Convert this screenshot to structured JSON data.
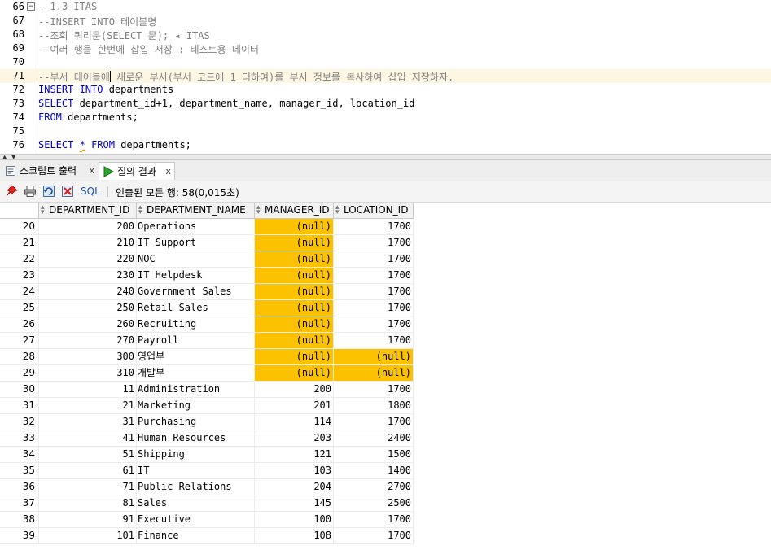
{
  "editor": {
    "lines": [
      {
        "num": "66",
        "text": "--1.3 ITAS",
        "fold": true
      },
      {
        "num": "67",
        "text": "--INSERT INTO 테이블명"
      },
      {
        "num": "68",
        "text": "--조회 쿼리문(SELECT 문); ◂ ITAS"
      },
      {
        "num": "69",
        "text": "--여러 행을 한번에 삽입 저장 : 테스트용 데이터"
      },
      {
        "num": "70",
        "text": ""
      },
      {
        "num": "71",
        "text_a": "--부서 테이블에",
        "text_b": "새로운 부서(부서 코드에 1 더하여)를 부서 정보를 복사하여 삽입 저장하자."
      },
      {
        "num": "72",
        "kw": "INSERT INTO",
        "rest": " departments"
      },
      {
        "num": "73",
        "kw": "SELECT",
        "rest": " department_id+1, department_name, manager_id, location_id"
      },
      {
        "num": "74",
        "kw": "FROM",
        "rest": " departments;"
      },
      {
        "num": "75",
        "text": ""
      },
      {
        "num": "76",
        "kw": "SELECT",
        "star": "*",
        "kw2": "FROM",
        "rest": " departments;"
      }
    ]
  },
  "tabs": [
    {
      "label": "스크립트 출력",
      "close": "x",
      "icon": "script-output-icon"
    },
    {
      "label": "질의 결과",
      "close": "x",
      "icon": "run-icon"
    }
  ],
  "toolbar": {
    "sql_label": "SQL",
    "status": "인출된 모든 행: 58(0,015초)"
  },
  "grid": {
    "headers": [
      "DEPARTMENT_ID",
      "DEPARTMENT_NAME",
      "MANAGER_ID",
      "LOCATION_ID"
    ],
    "highlight_color": "#fcc200",
    "rows": [
      {
        "rn": "20",
        "id": "200",
        "name": "Operations",
        "mgr": "(null)",
        "loc": "1700",
        "mgr_null": true
      },
      {
        "rn": "21",
        "id": "210",
        "name": "IT Support",
        "mgr": "(null)",
        "loc": "1700",
        "mgr_null": true
      },
      {
        "rn": "22",
        "id": "220",
        "name": "NOC",
        "mgr": "(null)",
        "loc": "1700",
        "mgr_null": true
      },
      {
        "rn": "23",
        "id": "230",
        "name": "IT Helpdesk",
        "mgr": "(null)",
        "loc": "1700",
        "mgr_null": true
      },
      {
        "rn": "24",
        "id": "240",
        "name": "Government Sales",
        "mgr": "(null)",
        "loc": "1700",
        "mgr_null": true
      },
      {
        "rn": "25",
        "id": "250",
        "name": "Retail Sales",
        "mgr": "(null)",
        "loc": "1700",
        "mgr_null": true
      },
      {
        "rn": "26",
        "id": "260",
        "name": "Recruiting",
        "mgr": "(null)",
        "loc": "1700",
        "mgr_null": true
      },
      {
        "rn": "27",
        "id": "270",
        "name": "Payroll",
        "mgr": "(null)",
        "loc": "1700",
        "mgr_null": true
      },
      {
        "rn": "28",
        "id": "300",
        "name": "영업부",
        "mgr": "(null)",
        "loc": "(null)",
        "mgr_null": true,
        "loc_null": true
      },
      {
        "rn": "29",
        "id": "310",
        "name": "개발부",
        "mgr": "(null)",
        "loc": "(null)",
        "mgr_null": true,
        "loc_null": true
      },
      {
        "rn": "30",
        "id": "11",
        "name": "Administration",
        "mgr": "200",
        "loc": "1700"
      },
      {
        "rn": "31",
        "id": "21",
        "name": "Marketing",
        "mgr": "201",
        "loc": "1800"
      },
      {
        "rn": "32",
        "id": "31",
        "name": "Purchasing",
        "mgr": "114",
        "loc": "1700"
      },
      {
        "rn": "33",
        "id": "41",
        "name": "Human Resources",
        "mgr": "203",
        "loc": "2400"
      },
      {
        "rn": "34",
        "id": "51",
        "name": "Shipping",
        "mgr": "121",
        "loc": "1500"
      },
      {
        "rn": "35",
        "id": "61",
        "name": "IT",
        "mgr": "103",
        "loc": "1400"
      },
      {
        "rn": "36",
        "id": "71",
        "name": "Public Relations",
        "mgr": "204",
        "loc": "2700"
      },
      {
        "rn": "37",
        "id": "81",
        "name": "Sales",
        "mgr": "145",
        "loc": "2500"
      },
      {
        "rn": "38",
        "id": "91",
        "name": "Executive",
        "mgr": "100",
        "loc": "1700"
      },
      {
        "rn": "39",
        "id": "101",
        "name": "Finance",
        "mgr": "108",
        "loc": "1700"
      }
    ]
  }
}
